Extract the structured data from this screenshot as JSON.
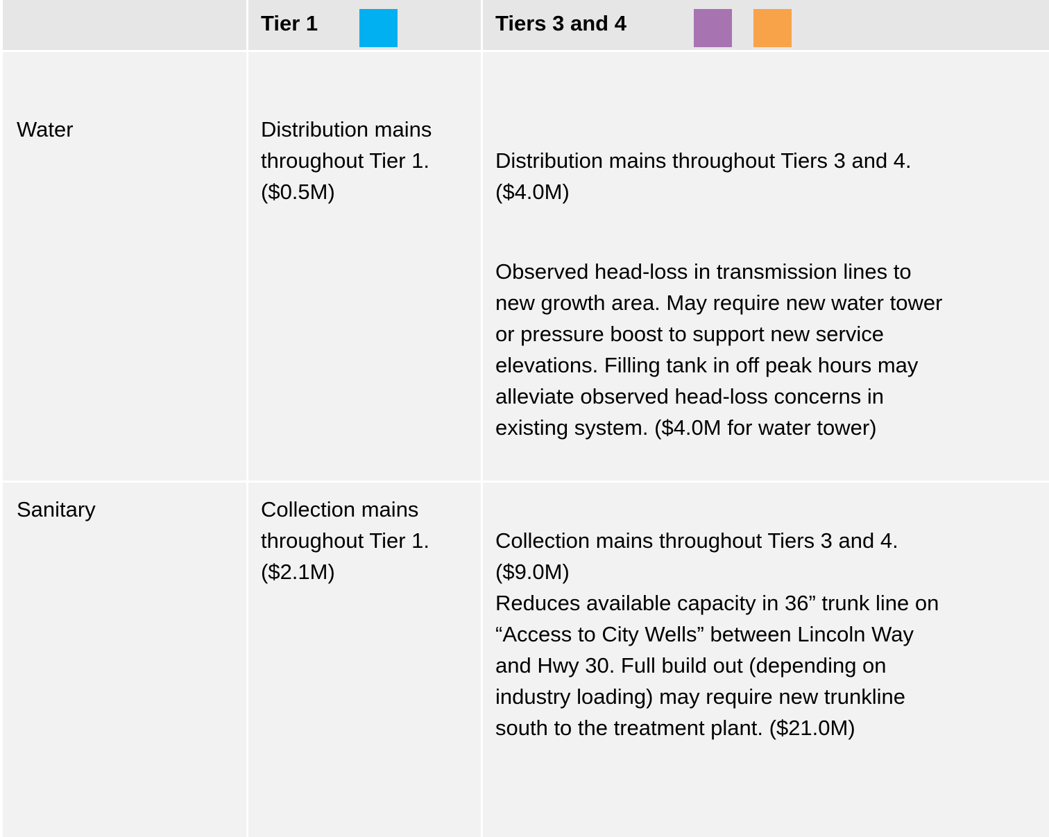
{
  "header": {
    "col1": "",
    "tier1": {
      "label": "Tier 1",
      "swatch_color": "#00b0f0"
    },
    "tiers34": {
      "label": "Tiers 3 and 4",
      "swatch_colors": [
        "#a873b1",
        "#f8a34a"
      ]
    }
  },
  "rows": [
    {
      "label": "Water",
      "tier1": "Distribution mains\nthroughout Tier 1.\n($0.5M)",
      "tiers34": [
        "Distribution mains throughout Tiers 3 and 4.\n($4.0M)",
        "Observed head-loss in transmission lines to\nnew growth area. May require new water tower\nor pressure boost to support new service\nelevations. Filling tank in off peak hours may\nalleviate observed head-loss concerns in\nexisting system. ($4.0M for water tower)"
      ]
    },
    {
      "label": "Sanitary",
      "tier1": "Collection mains\nthroughout Tier 1.\n($2.1M)",
      "tiers34": [
        "Collection mains throughout Tiers 3 and 4.\n($9.0M)\nReduces available capacity in 36” trunk line on\n“Access to City Wells” between Lincoln Way\nand Hwy 30. Full build out (depending on\nindustry loading) may require new trunkline\nsouth to the treatment plant. ($21.0M)"
      ]
    }
  ]
}
